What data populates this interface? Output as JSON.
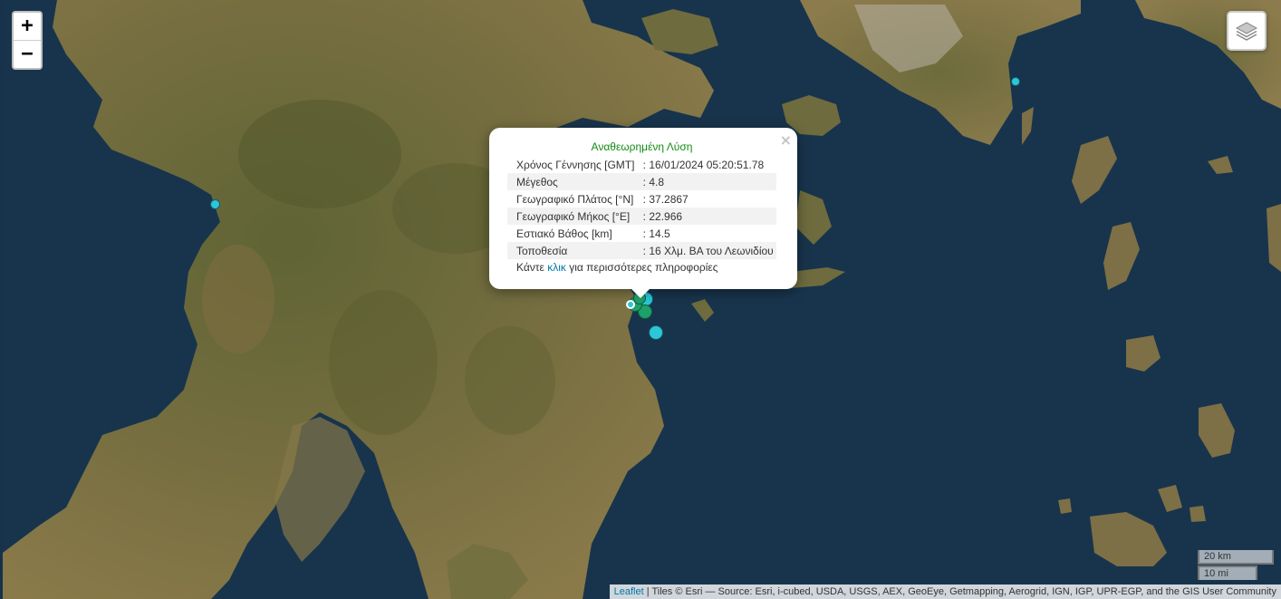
{
  "controls": {
    "zoom_in": "+",
    "zoom_out": "−"
  },
  "popup": {
    "title": "Αναθεωρημένη Λύση",
    "close": "×",
    "rows": [
      {
        "label": "Χρόνος Γέννησης [GMT]",
        "value": ": 16/01/2024 05:20:51.78"
      },
      {
        "label": "Μέγεθος",
        "value": ": 4.8"
      },
      {
        "label": "Γεωγραφικό Πλάτος [°N]",
        "value": ": 37.2867"
      },
      {
        "label": "Γεωγραφικό Μήκος [°E]",
        "value": ": 22.966"
      },
      {
        "label": "Εστιακό Βάθος [km]",
        "value": ": 14.5"
      },
      {
        "label": "Τοποθεσία",
        "value": ": 16 Χλμ. ΒΑ του Λεωνιδίου"
      }
    ],
    "footer_pre": "Κάντε ",
    "footer_link": "κλικ",
    "footer_post": " για περισσότερες πληροφορίες"
  },
  "scale": {
    "km": "20 km",
    "mi": "10 mi"
  },
  "attribution": {
    "leaflet": "Leaflet",
    "text": " | Tiles © Esri — Source: Esri, i-cubed, USDA, USGS, AEX, GeoEye, Getmapping, Aerogrid, IGN, IGP, UPR-EGP, and the GIS User Community"
  },
  "colors": {
    "sea": "#17324a",
    "land": "#6b6a3c",
    "marker_cyan": "#2bc7d8",
    "marker_green": "#1fa06a",
    "popup_title": "#138a13",
    "link": "#0078a8"
  }
}
